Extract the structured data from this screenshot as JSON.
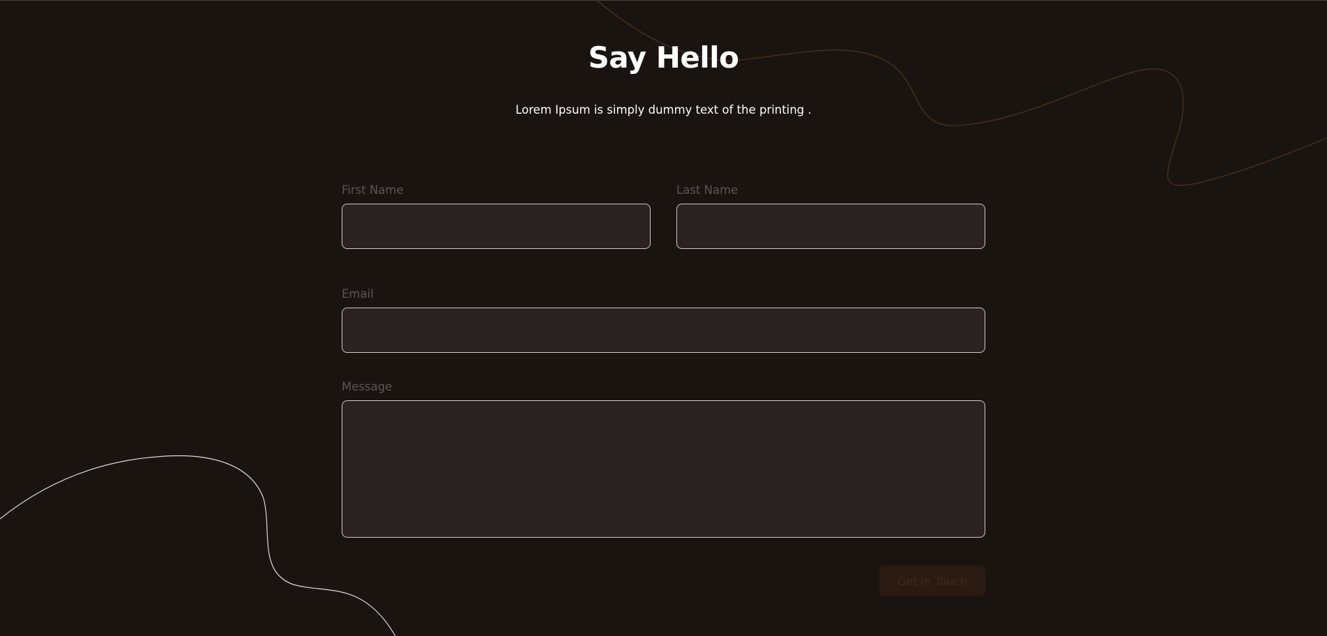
{
  "header": {
    "title": "Say Hello",
    "subtitle": "Lorem Ipsum is simply dummy text of the printing ."
  },
  "form": {
    "first_name": {
      "label": "First Name",
      "value": "",
      "placeholder": ""
    },
    "last_name": {
      "label": "Last Name",
      "value": "",
      "placeholder": ""
    },
    "email": {
      "label": "Email",
      "value": "",
      "placeholder": ""
    },
    "message": {
      "label": "Message",
      "value": "",
      "placeholder": ""
    },
    "submit_label": "Get in Touch"
  },
  "colors": {
    "background": "#1a1411",
    "field_background": "#2b2321",
    "field_border": "#cfcac7",
    "label_text": "#5b5653",
    "button_background": "#2a1a12",
    "button_text": "#3e2a1f",
    "accent_curve": "#5a3a22",
    "white_curve": "#d9d9d9"
  }
}
